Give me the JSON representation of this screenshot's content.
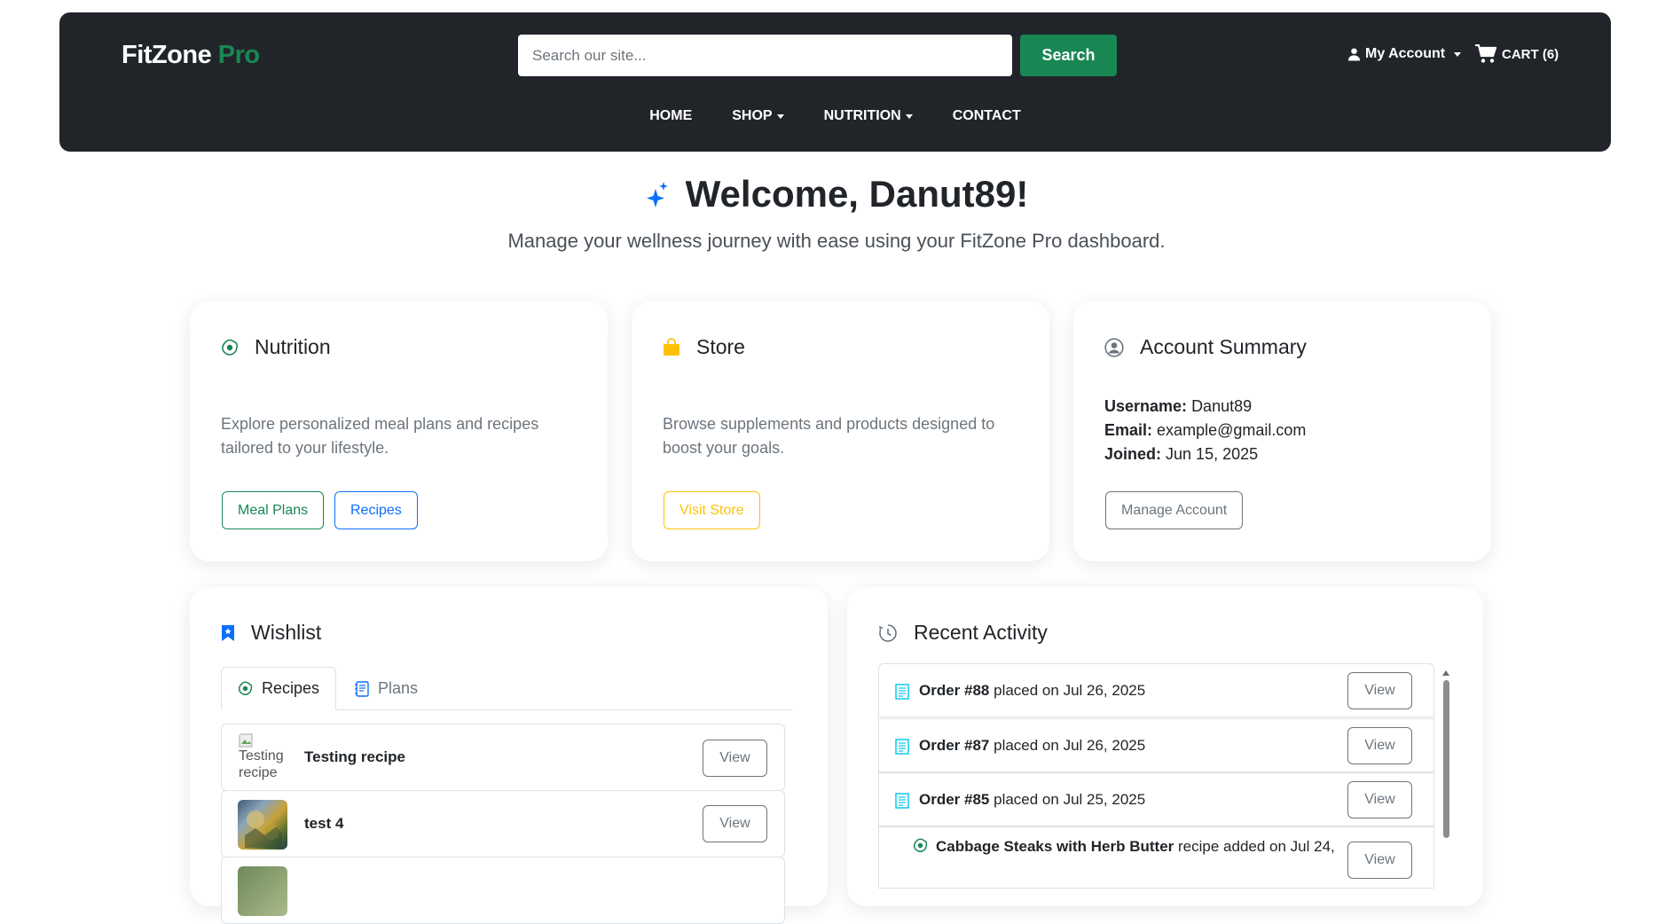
{
  "header": {
    "brand_main": "FitZone",
    "brand_accent": " Pro",
    "search_placeholder": "Search our site...",
    "search_label": "Search",
    "account_label": "My Account",
    "cart_label": "CART (6)",
    "nav": [
      "HOME",
      "SHOP",
      "NUTRITION",
      "CONTACT"
    ]
  },
  "welcome": {
    "title": "Welcome, Danut89!",
    "subtitle": "Manage your wellness journey with ease using your FitZone Pro dashboard."
  },
  "nutrition": {
    "title": "Nutrition",
    "desc": "Explore personalized meal plans and recipes tailored to your lifestyle.",
    "btn_meal_plans": "Meal Plans",
    "btn_recipes": "Recipes"
  },
  "store": {
    "title": "Store",
    "desc": "Browse supplements and products designed to boost your goals.",
    "btn_visit": "Visit Store"
  },
  "account": {
    "title": "Account Summary",
    "username_label": "Username:",
    "username": "Danut89",
    "email_label": "Email:",
    "email": "example@gmail.com",
    "joined_label": "Joined:",
    "joined": "Jun 15, 2025",
    "btn_manage": "Manage Account"
  },
  "wishlist": {
    "title": "Wishlist",
    "tabs": [
      "Recipes",
      "Plans"
    ],
    "items": [
      {
        "name": "Testing recipe",
        "alt": "Testing recipe",
        "view": "View"
      },
      {
        "name": "test 4",
        "view": "View"
      }
    ]
  },
  "activity": {
    "title": "Recent Activity",
    "items": [
      {
        "bold": "Order #88",
        "rest": " placed on Jul 26, 2025",
        "view": "View"
      },
      {
        "bold": "Order #87",
        "rest": " placed on Jul 26, 2025",
        "view": "View"
      },
      {
        "bold": "Order #85",
        "rest": " placed on Jul 25, 2025",
        "view": "View"
      },
      {
        "bold": "Cabbage Steaks with Herb Butter",
        "rest": " recipe added on Jul 24,",
        "view": "View"
      }
    ]
  },
  "colors": {
    "navbar": "#212529",
    "success": "#198754",
    "primary": "#0d6efd",
    "warning": "#ffc107",
    "info": "#0dcaf0",
    "secondary": "#6c757d"
  }
}
